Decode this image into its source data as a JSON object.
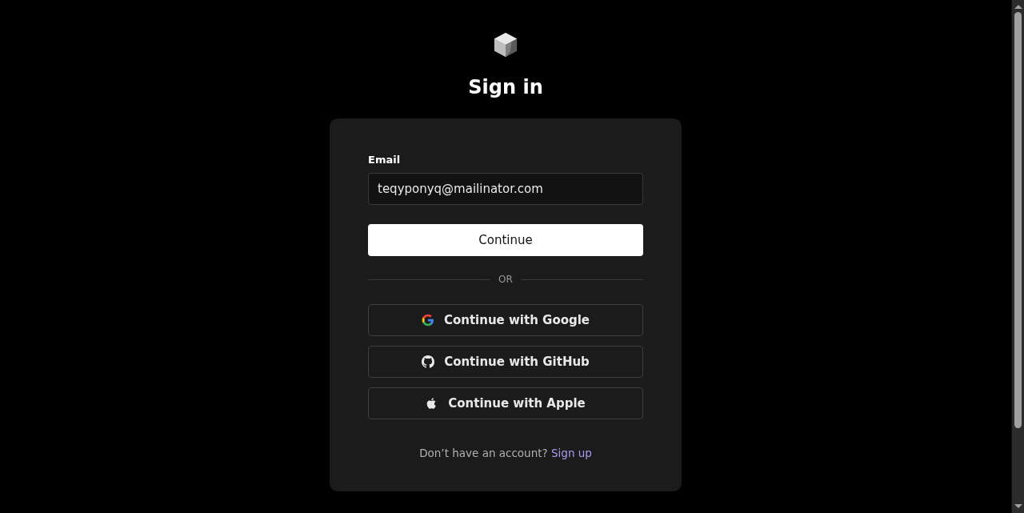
{
  "title": "Sign in",
  "email": {
    "label": "Email",
    "value": "teqyponyq@mailinator.com"
  },
  "continue_button": "Continue",
  "divider": "OR",
  "providers": [
    {
      "kind": "google",
      "label": "Continue with Google"
    },
    {
      "kind": "github",
      "label": "Continue with GitHub"
    },
    {
      "kind": "apple",
      "label": "Continue with Apple"
    }
  ],
  "footer": {
    "text": "Don’t have an account?",
    "link": "Sign up"
  }
}
